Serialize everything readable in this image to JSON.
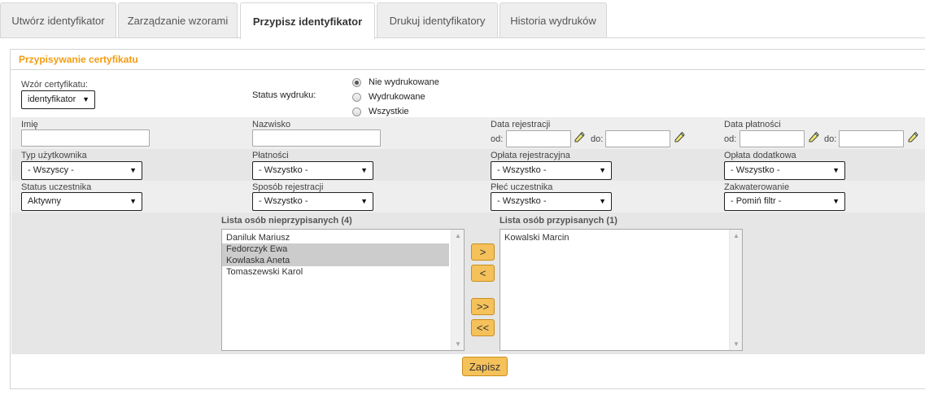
{
  "tabs": [
    {
      "label": "Utwórz identyfikator",
      "active": false
    },
    {
      "label": "Zarządzanie wzorami",
      "active": false
    },
    {
      "label": "Przypisz identyfikator",
      "active": true
    },
    {
      "label": "Drukuj identyfikatory",
      "active": false
    },
    {
      "label": "Historia wydruków",
      "active": false
    }
  ],
  "panel": {
    "title": "Przypisywanie certyfikatu"
  },
  "template": {
    "label": "Wzór certyfikatu:",
    "value": "identyfikator"
  },
  "print_status": {
    "label": "Status wydruku:",
    "options": [
      {
        "label": "Nie wydrukowane",
        "checked": true
      },
      {
        "label": "Wydrukowane",
        "checked": false
      },
      {
        "label": "Wszystkie",
        "checked": false
      }
    ]
  },
  "filters": {
    "first_name": {
      "label": "Imię",
      "value": ""
    },
    "last_name": {
      "label": "Nazwisko",
      "value": ""
    },
    "registration_date": {
      "label": "Data rejestracji",
      "from_label": "od:",
      "to_label": "do:",
      "from": "",
      "to": ""
    },
    "payment_date": {
      "label": "Data płatności",
      "from_label": "od:",
      "to_label": "do:",
      "from": "",
      "to": ""
    },
    "user_type": {
      "label": "Typ użytkownika",
      "value": "- Wszyscy -"
    },
    "payments": {
      "label": "Płatności",
      "value": "- Wszystko -"
    },
    "registration_fee": {
      "label": "Opłata rejestracyjna",
      "value": "- Wszystko -"
    },
    "additional_fee": {
      "label": "Opłata dodatkowa",
      "value": "- Wszystko -"
    },
    "participant_status": {
      "label": "Status uczestnika",
      "value": "Aktywny"
    },
    "registration_method": {
      "label": "Sposób rejestracji",
      "value": "- Wszystko -"
    },
    "gender": {
      "label": "Płeć uczestnika",
      "value": "- Wszystko -"
    },
    "accommodation": {
      "label": "Zakwaterowanie",
      "value": "- Pomiń filtr -"
    }
  },
  "unassigned": {
    "title": "Lista osób nieprzypisanych (4)",
    "items": [
      {
        "name": "Daniluk Mariusz",
        "selected": false
      },
      {
        "name": "Fedorczyk Ewa",
        "selected": true
      },
      {
        "name": "Kowlaska Aneta",
        "selected": true
      },
      {
        "name": "Tomaszewski Karol",
        "selected": false
      }
    ]
  },
  "assigned": {
    "title": "Lista osób przypisanych (1)",
    "items": [
      {
        "name": "Kowalski Marcin",
        "selected": false
      }
    ]
  },
  "move_buttons": {
    "add": ">",
    "remove": "<",
    "add_all": ">>",
    "remove_all": "<<"
  },
  "save_label": "Zapisz",
  "icons": {
    "dropdown": "caret-down-icon",
    "date_picker": "pencil-icon",
    "scroll": "scroll-arrow-icon"
  },
  "colors": {
    "accent": "#f39c12",
    "button": "#f5c15a",
    "band": "#eeeeee",
    "selection": "#cccccc"
  }
}
